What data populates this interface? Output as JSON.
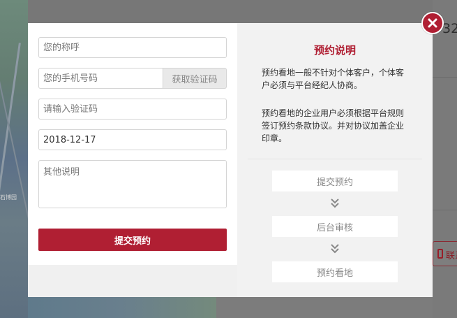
{
  "background": {
    "number_fragment": "32",
    "contact_fragment": "联系",
    "map_labels": [
      "石博园"
    ]
  },
  "form": {
    "name_placeholder": "您的称呼",
    "phone_placeholder": "您的手机号码",
    "get_code_label": "获取验证码",
    "code_placeholder": "请输入验证码",
    "date_value": "2018-12-17",
    "notes_placeholder": "其他说明",
    "submit_label": "提交预约"
  },
  "info": {
    "title": "预约说明",
    "paragraph1": "预约看地一般不针对个体客户，个体客户必须与平台经纪人协商。",
    "paragraph2": "预约看地的企业用户必须根据平台规则签订预约条款协议。并对协议加盖企业印章。",
    "steps": [
      "提交预约",
      "后台审核",
      "预约看地"
    ]
  },
  "colors": {
    "accent": "#b01f33",
    "info_bg": "#f2f2f2"
  },
  "icons": {
    "close": "close-icon",
    "arrow": "double-chevron-down-icon",
    "phone": "phone-icon"
  }
}
